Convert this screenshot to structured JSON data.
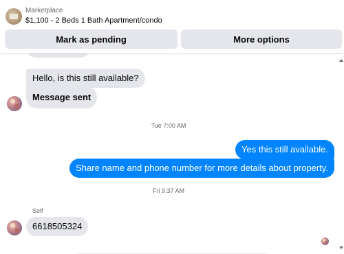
{
  "header": {
    "category": "Marketplace",
    "title": "$1,100 - 2 Beds 1 Bath Apartment/condo",
    "buttons": {
      "pending": "Mark as pending",
      "more": "More options"
    }
  },
  "messages": {
    "incoming_1": "Hello, is this still available?",
    "incoming_2": "Message sent",
    "timestamp_1": "Tue 7:00 AM",
    "outgoing_1": "Yes this still available.",
    "outgoing_2": "Share name and phone number for more details about property.",
    "timestamp_2": "Fri 9:37 AM",
    "sender": "Self",
    "incoming_3": "6618505324"
  },
  "colors": {
    "outgoing_bubble": "#0084ff",
    "incoming_bubble": "#e4e6eb",
    "button_bg": "#e4e6eb"
  },
  "icons": {
    "listing_thumbnail": "listing-thumbnail-icon",
    "avatar": "avatar-icon",
    "read_receipt": "read-receipt-icon",
    "scroll_up": "scroll-up-arrow-icon",
    "scroll_down": "scroll-down-arrow-icon"
  }
}
